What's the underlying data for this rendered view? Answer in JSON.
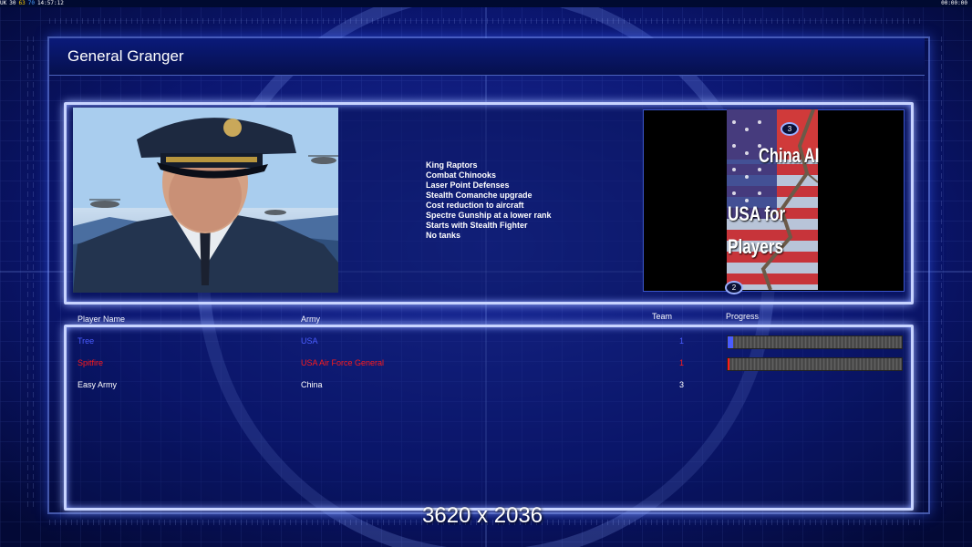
{
  "status_bar": {
    "left_items": [
      {
        "text": "UK",
        "color": "#ffffff"
      },
      {
        "text": "30",
        "color": "#ffffff"
      },
      {
        "text": "63",
        "color": "#ffd200"
      },
      {
        "text": "70",
        "color": "#4aa0ff"
      },
      {
        "text": "14:57:12",
        "color": "#ffffff"
      }
    ],
    "right_time": "00:00:00"
  },
  "general": {
    "title": "General Granger",
    "features": [
      "King Raptors",
      "Combat Chinooks",
      "Laser Point Defenses",
      "Stealth Comanche upgrade",
      "Cost reduction to aircraft",
      "Spectre Gunship at a lower rank",
      "Starts with Stealth Fighter",
      "No tanks"
    ]
  },
  "map": {
    "title_top": "China AI",
    "title_bottom_1": "USA for",
    "title_bottom_2": "Players",
    "start_positions": [
      "3",
      "2"
    ]
  },
  "player_list": {
    "headers": {
      "name": "Player Name",
      "army": "Army",
      "team": "Team",
      "progress": "Progress"
    },
    "players": [
      {
        "name": "Tree",
        "army": "USA",
        "team": "1",
        "color": "#4a5cff",
        "progress": 0.03,
        "has_progress": true
      },
      {
        "name": "Spitfire",
        "army": "USA Air Force General",
        "team": "1",
        "color": "#ff1a1a",
        "progress": 0.01,
        "has_progress": true
      },
      {
        "name": "Easy Army",
        "army": "China",
        "team": "3",
        "color": "#ffffff",
        "progress": 0,
        "has_progress": false
      }
    ]
  },
  "overlay_text": "3620 x 2036",
  "colors": {
    "background": "#08104a",
    "panel_border": "#c8d4ff",
    "accent": "#9fb4ff"
  }
}
